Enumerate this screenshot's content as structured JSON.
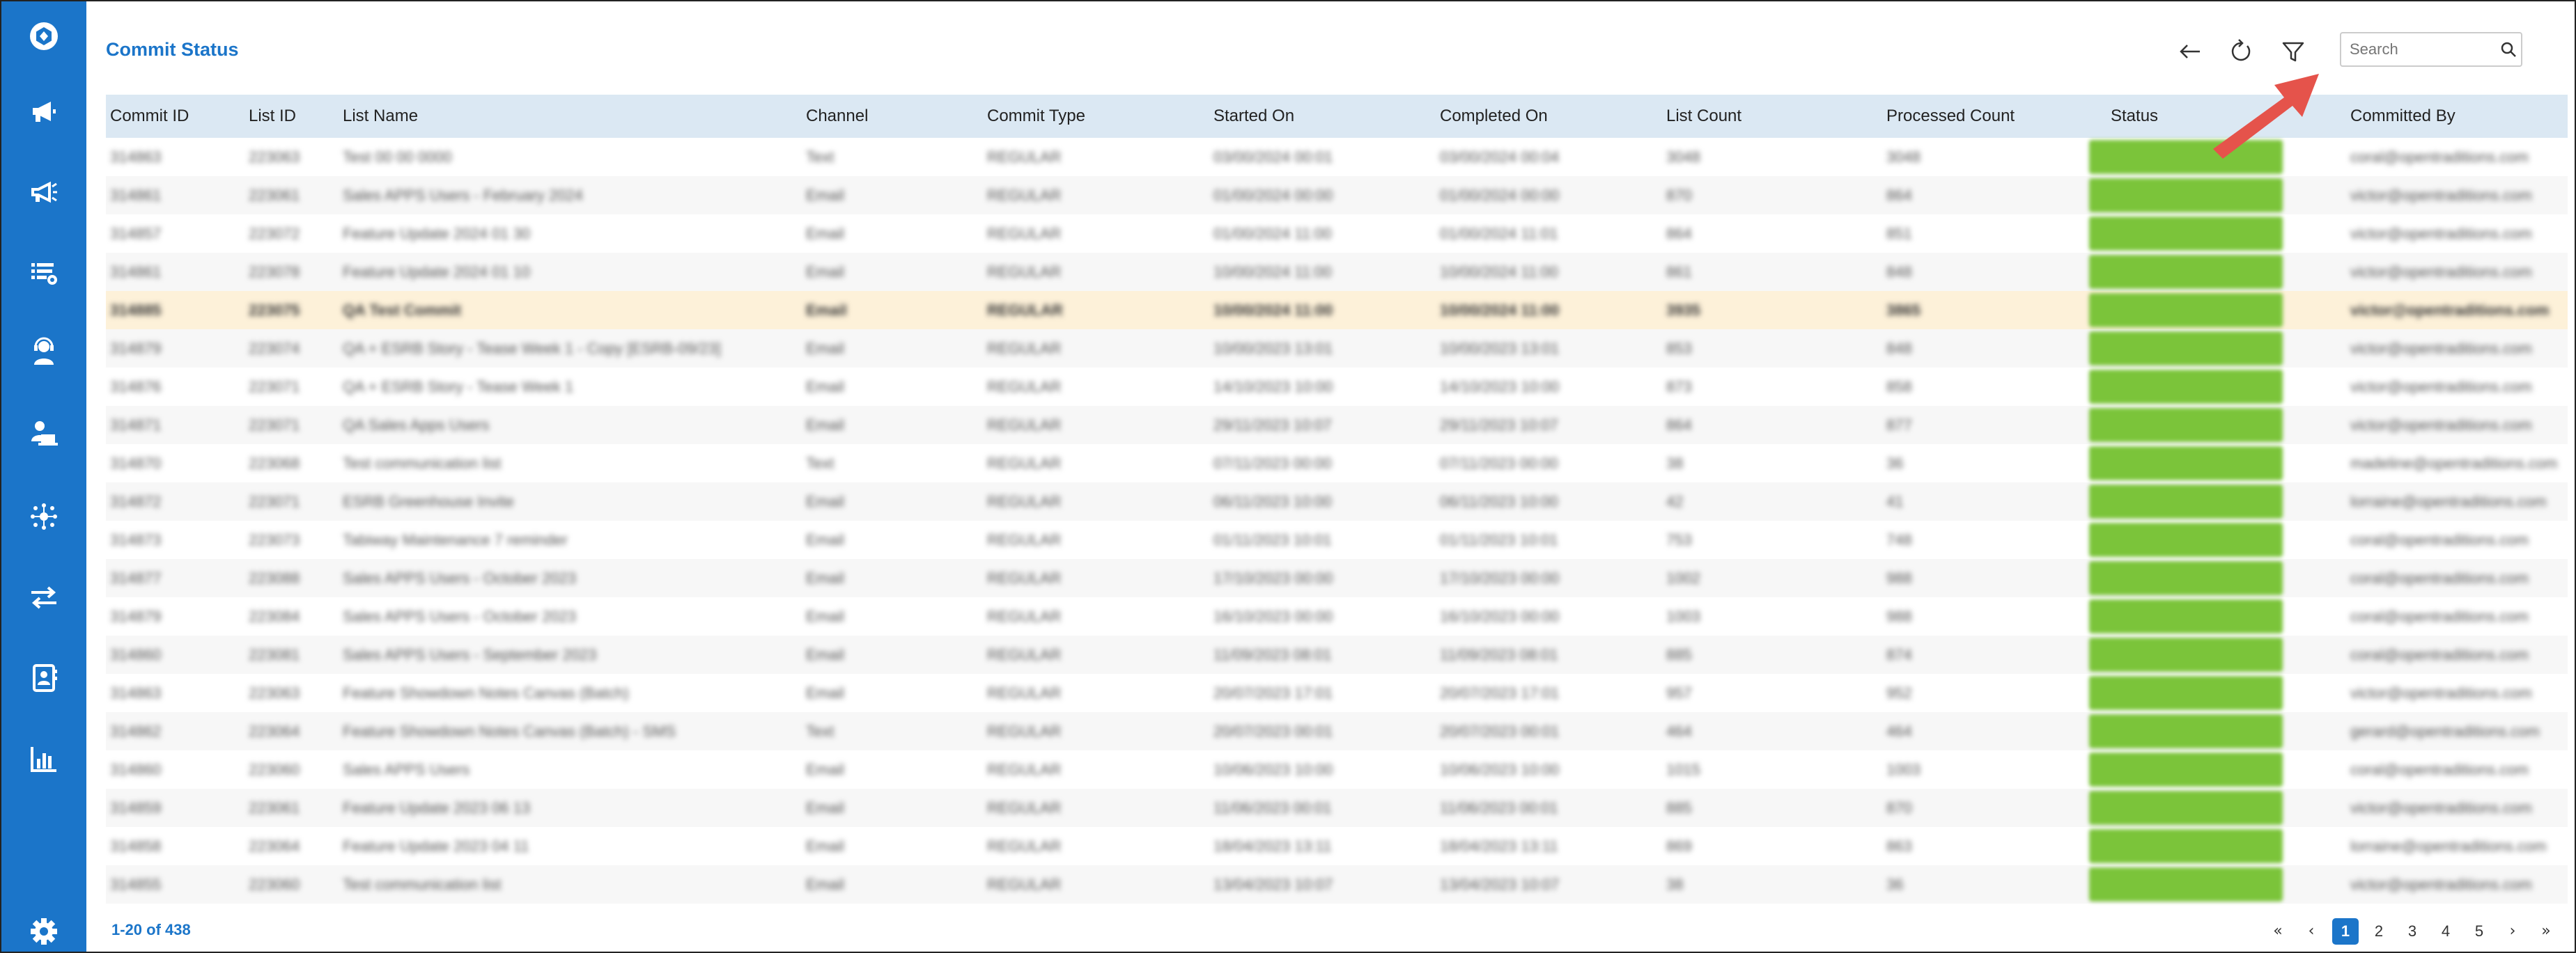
{
  "page": {
    "title": "Commit Status"
  },
  "toolbar": {
    "search_placeholder": "Search",
    "back_icon": "arrow-left-icon",
    "refresh_icon": "refresh-icon",
    "filter_icon": "filter-icon",
    "search_icon": "search-icon"
  },
  "sidebar": {
    "icons": [
      "logo-icon",
      "megaphone-icon",
      "megaphone-alt-icon",
      "list-settings-icon",
      "user-support-icon",
      "user-laptop-icon",
      "network-icon",
      "transfer-icon",
      "contacts-icon",
      "bar-chart-icon",
      "gear-icon"
    ]
  },
  "table": {
    "columns": [
      "Commit ID",
      "List ID",
      "List Name",
      "Channel",
      "Commit Type",
      "Started On",
      "Completed On",
      "List Count",
      "Processed Count",
      "Status",
      "Committed By"
    ],
    "rows": [
      [
        "314863",
        "223063",
        "Test 00 00 0000",
        "Text",
        "REGULAR",
        "03/00/2024 00:01",
        "03/00/2024 00:04",
        "3048",
        "3048",
        "",
        "coral@opentraditions.com"
      ],
      [
        "314861",
        "223061",
        "Sales APPS Users - February 2024",
        "Email",
        "REGULAR",
        "01/00/2024 00:00",
        "01/00/2024 00:00",
        "870",
        "864",
        "",
        "victor@opentraditions.com"
      ],
      [
        "314857",
        "223072",
        "Feature Update 2024 01 30",
        "Email",
        "REGULAR",
        "01/00/2024 11:00",
        "01/00/2024 11:01",
        "864",
        "851",
        "",
        "victor@opentraditions.com"
      ],
      [
        "314861",
        "223078",
        "Feature Update 2024 01 10",
        "Email",
        "REGULAR",
        "10/00/2024 11:00",
        "10/00/2024 11:00",
        "861",
        "848",
        "",
        "victor@opentraditions.com"
      ],
      [
        "314885",
        "223075",
        "QA Test Commit",
        "Email",
        "REGULAR",
        "10/00/2024 11:00",
        "10/00/2024 11:00",
        "3935",
        "3865",
        "",
        "victor@opentraditions.com"
      ],
      [
        "314879",
        "223074",
        "QA + ESRB Story - Tease Week 1 - Copy [ESRB-09/23]",
        "Email",
        "REGULAR",
        "10/00/2023 13:01",
        "10/00/2023 13:01",
        "853",
        "848",
        "",
        "victor@opentraditions.com"
      ],
      [
        "314876",
        "223071",
        "QA + ESRB Story - Tease Week 1",
        "Email",
        "REGULAR",
        "14/10/2023 10:00",
        "14/10/2023 10:00",
        "873",
        "858",
        "",
        "victor@opentraditions.com"
      ],
      [
        "314871",
        "223071",
        "QA Sales Apps Users",
        "Email",
        "REGULAR",
        "29/11/2023 10:07",
        "29/11/2023 10:07",
        "864",
        "877",
        "",
        "victor@opentraditions.com"
      ],
      [
        "314870",
        "223068",
        "Test communication list",
        "Text",
        "REGULAR",
        "07/11/2023 00:00",
        "07/11/2023 00:00",
        "38",
        "36",
        "",
        "madeline@opentraditions.com"
      ],
      [
        "314872",
        "223071",
        "ESRB Greenhouse Invite",
        "Email",
        "REGULAR",
        "06/11/2023 10:00",
        "06/11/2023 10:00",
        "42",
        "41",
        "",
        "lorraine@opentraditions.com"
      ],
      [
        "314873",
        "223073",
        "Tabiway Maintenance 7 reminder",
        "Email",
        "REGULAR",
        "01/11/2023 10:01",
        "01/11/2023 10:01",
        "753",
        "748",
        "",
        "coral@opentraditions.com"
      ],
      [
        "314877",
        "223088",
        "Sales APPS Users - October 2023",
        "Email",
        "REGULAR",
        "17/10/2023 00:00",
        "17/10/2023 00:00",
        "1002",
        "988",
        "",
        "coral@opentraditions.com"
      ],
      [
        "314879",
        "223084",
        "Sales APPS Users - October 2023",
        "Email",
        "REGULAR",
        "16/10/2023 00:00",
        "16/10/2023 00:00",
        "1003",
        "988",
        "",
        "coral@opentraditions.com"
      ],
      [
        "314860",
        "223081",
        "Sales APPS Users - September 2023",
        "Email",
        "REGULAR",
        "11/09/2023 08:01",
        "11/09/2023 08:01",
        "885",
        "874",
        "",
        "coral@opentraditions.com"
      ],
      [
        "314863",
        "223063",
        "Feature Showdown Notes Canvas (Batch)",
        "Email",
        "REGULAR",
        "20/07/2023 17:01",
        "20/07/2023 17:01",
        "957",
        "952",
        "",
        "victor@opentraditions.com"
      ],
      [
        "314862",
        "223064",
        "Feature Showdown Notes Canvas (Batch) - SMS",
        "Text",
        "REGULAR",
        "20/07/2023 00:01",
        "20/07/2023 00:01",
        "464",
        "464",
        "",
        "gerard@opentraditions.com"
      ],
      [
        "314860",
        "223060",
        "Sales APPS Users",
        "Email",
        "REGULAR",
        "10/06/2023 10:00",
        "10/06/2023 10:00",
        "1015",
        "1003",
        "",
        "coral@opentraditions.com"
      ],
      [
        "314859",
        "223061",
        "Feature Update 2023 06 13",
        "Email",
        "REGULAR",
        "11/06/2023 00:01",
        "11/06/2023 00:01",
        "885",
        "870",
        "",
        "victor@opentraditions.com"
      ],
      [
        "314858",
        "223064",
        "Feature Update 2023 04 11",
        "Email",
        "REGULAR",
        "18/04/2023 13:11",
        "18/04/2023 13:11",
        "869",
        "863",
        "",
        "lorraine@opentraditions.com"
      ],
      [
        "314855",
        "223060",
        "Test communication list",
        "Email",
        "REGULAR",
        "13/04/2023 10:07",
        "13/04/2023 10:07",
        "38",
        "36",
        "",
        "victor@opentraditions.com"
      ]
    ]
  },
  "pager": {
    "summary": "1-20 of 438",
    "first": "«",
    "prev": "‹",
    "pages": [
      "1",
      "2",
      "3",
      "4",
      "5"
    ],
    "next": "›",
    "last": "»"
  },
  "colors": {
    "brand": "#1b75c9",
    "header_bg": "#dbe8f3",
    "status_green": "#7bc43a",
    "highlight_row": "#fdf1d9",
    "annotation_arrow": "#e5534b"
  }
}
